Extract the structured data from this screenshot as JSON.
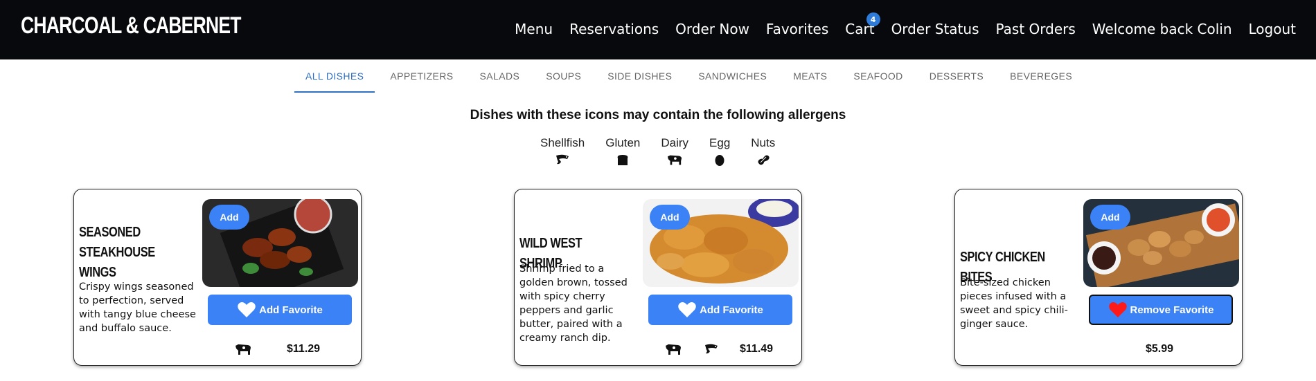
{
  "header": {
    "brand": "CHARCOAL & CABERNET",
    "nav": [
      "Menu",
      "Reservations",
      "Order Now",
      "Favorites",
      "Cart",
      "Order Status",
      "Past Orders",
      "Welcome back Colin",
      "Logout"
    ],
    "cart_count": "4"
  },
  "tabs": [
    "ALL DISHES",
    "APPETIZERS",
    "SALADS",
    "SOUPS",
    "SIDE DISHES",
    "SANDWICHES",
    "MEATS",
    "SEAFOOD",
    "DESSERTS",
    "BEVEREGES"
  ],
  "active_tab": "ALL DISHES",
  "allergens": {
    "title": "Dishes with these icons may contain the following allergens",
    "items": [
      {
        "label": "Shellfish",
        "icon": "shrimp-icon"
      },
      {
        "label": "Gluten",
        "icon": "bread-icon"
      },
      {
        "label": "Dairy",
        "icon": "cow-icon"
      },
      {
        "label": "Egg",
        "icon": "egg-icon"
      },
      {
        "label": "Nuts",
        "icon": "peanut-icon"
      }
    ]
  },
  "dishes": [
    {
      "name": "Seasoned Steakhouse Wings",
      "description": "Crispy wings seasoned to perfection, served with tangy blue cheese and buffalo sauce.",
      "add_label": "Add",
      "favorite_label": "Add Favorite",
      "favorited": false,
      "allergen_icons": [
        "cow-icon"
      ],
      "price": "$11.29"
    },
    {
      "name": "Wild West Shrimp",
      "description": "Shrimp fried to a golden brown, tossed with spicy cherry peppers and garlic butter, paired with a creamy ranch dip.",
      "add_label": "Add",
      "favorite_label": "Add Favorite",
      "favorited": false,
      "allergen_icons": [
        "cow-icon",
        "shrimp-icon"
      ],
      "price": "$11.49"
    },
    {
      "name": "Spicy Chicken Bites",
      "description": "Bite-sized chicken pieces infused with a sweet and spicy chili-ginger sauce.",
      "add_label": "Add",
      "favorite_label": "Remove Favorite",
      "favorited": true,
      "allergen_icons": [],
      "price": "$5.99"
    }
  ],
  "colors": {
    "header_bg": "#07090c",
    "accent": "#3b82f6",
    "tab_active": "#2f6fc4",
    "heart_favorited": "#ff1a1a",
    "heart_default": "#ffffff"
  }
}
